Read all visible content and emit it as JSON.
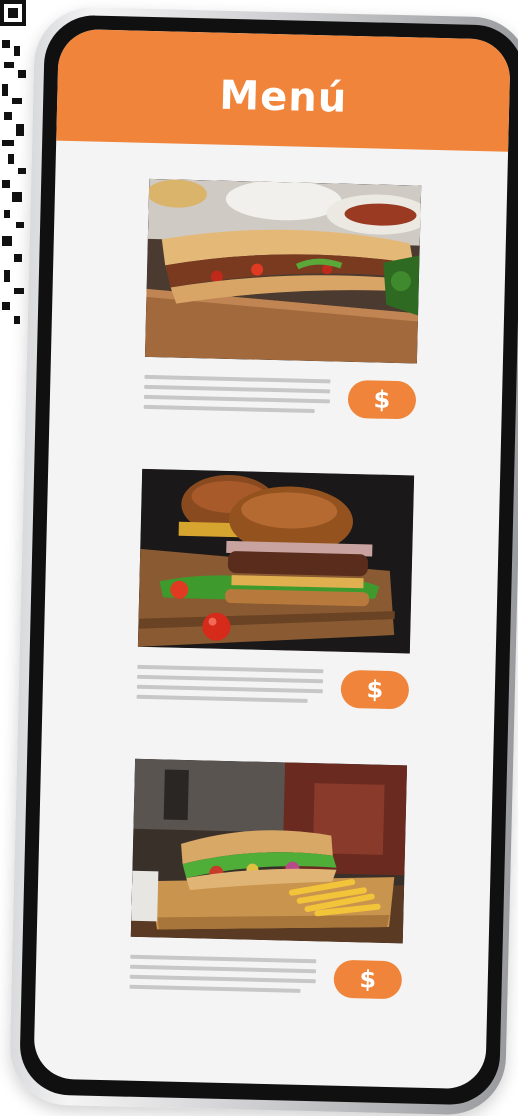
{
  "header": {
    "title": "Menú"
  },
  "menu_items": [
    {
      "image_icon": "baguette-sandwich-photo-icon",
      "price_label": "$"
    },
    {
      "image_icon": "burger-photo-icon",
      "price_label": "$"
    },
    {
      "image_icon": "sub-sandwich-fries-photo-icon",
      "price_label": "$"
    }
  ],
  "colors": {
    "accent": "#F0843A",
    "screen_background": "#F4F4F4",
    "placeholder_text_line": "#C7C7C7",
    "phone_bezel": "#101010"
  }
}
